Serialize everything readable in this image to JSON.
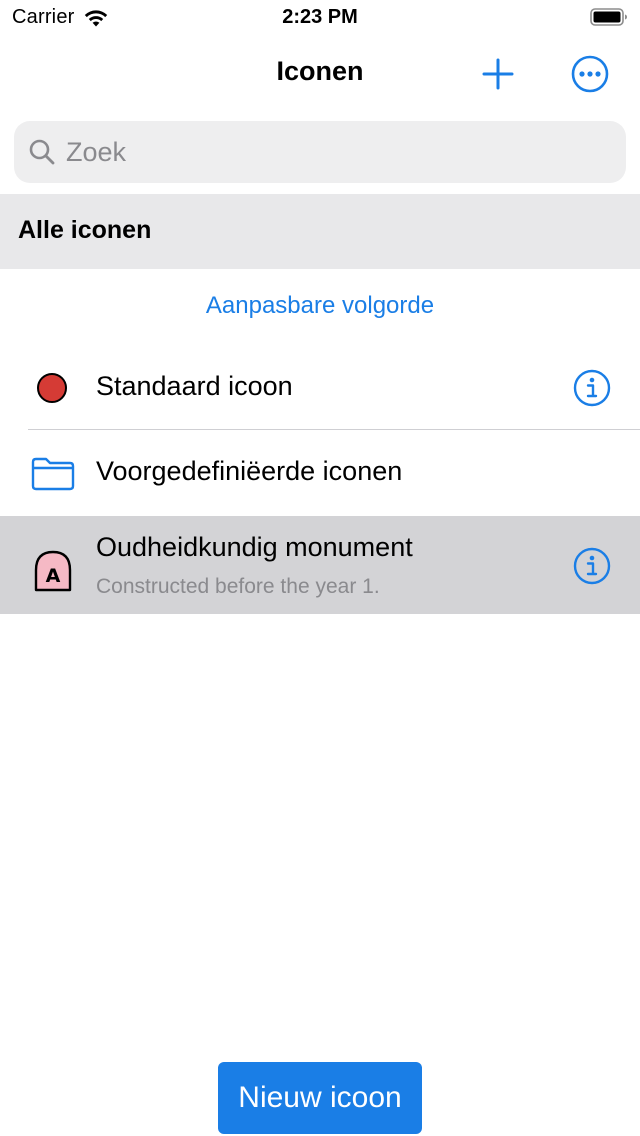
{
  "status_bar": {
    "carrier": "Carrier",
    "time": "2:23 PM"
  },
  "nav": {
    "title": "Iconen",
    "add_icon": "plus-icon",
    "more_icon": "ellipsis-circle-icon"
  },
  "search": {
    "placeholder": "Zoek",
    "value": ""
  },
  "section": {
    "header": "Alle iconen",
    "reorder_label": "Aanpasbare volgorde"
  },
  "rows": [
    {
      "label": "Standaard icoon",
      "icon": "red-dot-icon",
      "has_info": true
    },
    {
      "label": "Voorgedefiniëerde iconen",
      "icon": "folder-icon",
      "has_info": false
    },
    {
      "label": "Oudheidkundig monument",
      "subtitle": "Constructed before the year 1.",
      "icon": "monument-a-icon",
      "has_info": true,
      "selected": true
    }
  ],
  "footer": {
    "new_button_label": "Nieuw icoon"
  },
  "colors": {
    "accent": "#1a7ee6",
    "selected_row": "#d3d3d6",
    "section_header_bg": "#e8e8ea",
    "standard_dot": "#d53b35",
    "monument_fill": "#f5b9c5"
  }
}
